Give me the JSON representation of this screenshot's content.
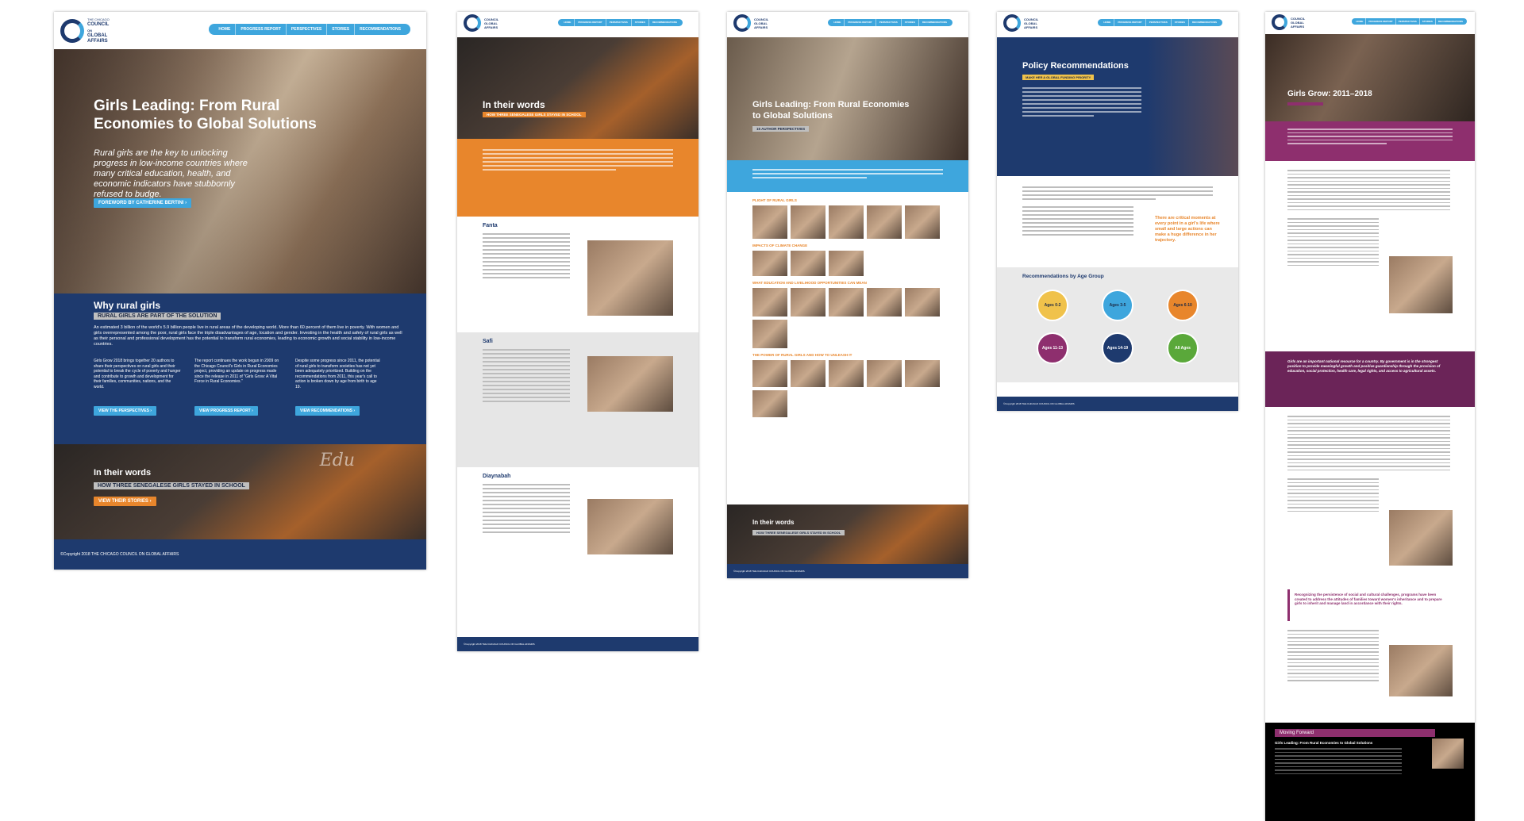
{
  "site": {
    "logo_line1": "THE CHICAGO",
    "logo_line2": "COUNCIL",
    "logo_line3": "ON",
    "logo_line4": "GLOBAL",
    "logo_line5": "AFFAIRS",
    "nav": [
      "HOME",
      "PROGRESS REPORT",
      "PERSPECTIVES",
      "STORIES",
      "RECOMMENDATIONS"
    ],
    "copyright": "©Copyright 2018 THE CHICAGO COUNCIL ON GLOBAL AFFAIRS",
    "colors": {
      "navy": "#1e3a6e",
      "blue": "#3ea6dd",
      "orange": "#e8862c",
      "magenta": "#8e2f6e",
      "gold": "#f0c24b"
    }
  },
  "home": {
    "title": "Girls Leading: From Rural Economies to Global Solutions",
    "subtitle": "Rural girls are the key to unlocking progress in low-income countries where many critical education, health, and economic indicators have stubbornly refused to budge.",
    "foreword_button": "FOREWORD BY CATHERINE BERTINI ›",
    "why_heading": "Why rural girls",
    "why_tag": "RURAL GIRLS ARE PART OF THE SOLUTION",
    "why_text": "An estimated 3 billion of the world's 5.9 billion people live in rural areas of the developing world. More than 60 percent of them live in poverty. With women and girls overrepresented among the poor, rural girls face the triple disadvantages of age, location and gender. Investing in the health and safety of rural girls as well as their personal and professional development has the potential to transform rural economies, leading to economic growth and social stability in low-income countries.",
    "col1": "Girls Grow 2018 brings together 20 authors to share their perspectives on rural girls and their potential to break the cycle of poverty and hunger and contribute to growth and development for their families, communities, nations, and the world.",
    "col2": "The report continues the work begun in 2009 on the Chicago Council's Girls in Rural Economies project, providing an update on progress made since the release in 2011 of \"Girls Grow: A Vital Force in Rural Economies.\"",
    "col3": "Despite some progress since 2011, the potential of rural girls to transform societies has not yet been adequately prioritized. Building on the recommendations from 2011, this year's call to action is broken down by age from birth to age 19.",
    "btn1": "VIEW THE PERSPECTIVES ›",
    "btn2": "VIEW PROGRESS REPORT ›",
    "btn3": "VIEW RECOMMENDATIONS ›",
    "words_heading": "In their words",
    "words_tag": "HOW THREE SENEGALESE GIRLS STAYED IN SCHOOL",
    "stories_button": "VIEW THEIR STORIES ›",
    "chalk_word": "Edu"
  },
  "stories": {
    "heading": "In their words",
    "tag": "HOW THREE SENEGALESE GIRLS STAYED IN SCHOOL",
    "names": [
      "Fanta",
      "Safi",
      "Diaynabah"
    ]
  },
  "perspectives": {
    "title": "Girls Leading: From Rural Economies to Global Solutions",
    "tag": "15 AUTHOR PERSPECTIVES",
    "sections": [
      "PLIGHT OF RURAL GIRLS",
      "IMPACTS OF CLIMATE CHANGE",
      "WHAT EDUCATION AND LIVELIHOOD OPPORTUNITIES CAN MEAN",
      "THE POWER OF RURAL GIRLS AND HOW TO UNLEASH IT"
    ],
    "words_heading": "In their words",
    "words_tag": "HOW THREE SENEGALESE GIRLS STAYED IN SCHOOL"
  },
  "recommendations": {
    "title": "Policy Recommendations",
    "tag": "MAKE HER A GLOBAL FUNDING PRIORITY",
    "callout": "There are critical moments at every point in a girl's life where small and large actions can make a huge difference in her trajectory.",
    "age_heading": "Recommendations by Age Group",
    "ages": [
      "Ages 0-2",
      "Ages 3-5",
      "Ages 6-10",
      "Ages 11-13",
      "Ages 14-19",
      "All Ages"
    ]
  },
  "progress": {
    "title": "Girls Grow: 2011–2018",
    "quote1": "Girls are an important national resource for a country. By government is in the strongest position to provide meaningful growth and positive guardianship through the provision of education, social protection, health care, legal rights, and access to agricultural assets.",
    "quote2": "Recognizing the persistence of social and cultural challenges, programs have been created to address the attitudes of families toward women's inheritance and to prepare girls to inherit and manage land in accordance with their rights.",
    "moving_forward": "Moving Forward",
    "mf_title": "Girls Leading: From Rural Economies to Global Solutions"
  }
}
